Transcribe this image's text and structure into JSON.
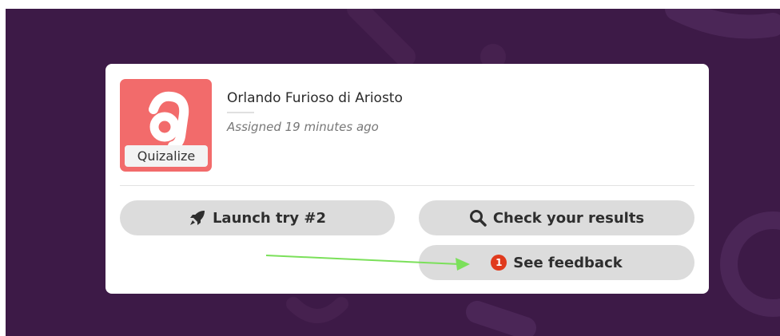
{
  "card": {
    "thumbnail": {
      "logo_letter": "a",
      "label": "Quizalize"
    },
    "title": "Orlando Furioso di Ariosto",
    "assigned": "Assigned 19 minutes ago"
  },
  "buttons": {
    "launch": {
      "label": "Launch try #2",
      "icon": "rocket-icon"
    },
    "check": {
      "label": "Check your results",
      "icon": "search-icon"
    },
    "feedback": {
      "label": "See feedback",
      "badge": "1"
    }
  },
  "colors": {
    "background": "#3d1a47",
    "thumbnail": "#f26b6b",
    "button": "#dcdcdc",
    "badge": "#e03a1d",
    "annotation_arrow": "#7be05a"
  }
}
